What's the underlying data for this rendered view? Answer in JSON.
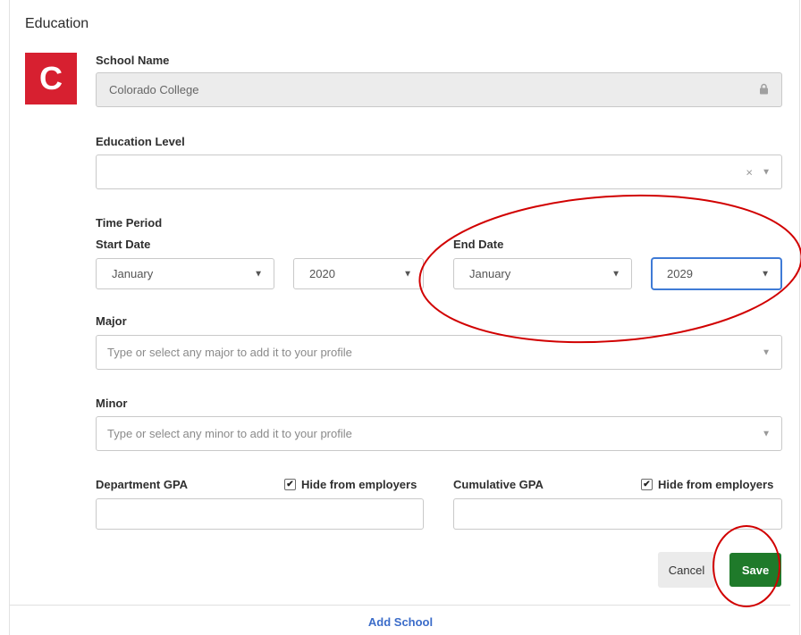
{
  "section": {
    "title": "Education"
  },
  "school": {
    "logo_letter": "C",
    "label": "School Name",
    "value": "Colorado College"
  },
  "education_level": {
    "label": "Education Level",
    "value": ""
  },
  "time_period": {
    "label": "Time Period",
    "start": {
      "label": "Start Date",
      "month": "January",
      "year": "2020"
    },
    "end": {
      "label": "End Date",
      "month": "January",
      "year": "2029"
    }
  },
  "major": {
    "label": "Major",
    "placeholder": "Type or select any major to add it to your profile"
  },
  "minor": {
    "label": "Minor",
    "placeholder": "Type or select any minor to add it to your profile"
  },
  "gpa": {
    "department": {
      "label": "Department GPA",
      "hide_label": "Hide from employers",
      "hidden": true,
      "value": ""
    },
    "cumulative": {
      "label": "Cumulative GPA",
      "hide_label": "Hide from employers",
      "hidden": true,
      "value": ""
    }
  },
  "actions": {
    "cancel": "Cancel",
    "save": "Save"
  },
  "footer": {
    "add_school": "Add School"
  },
  "colors": {
    "logo": "#d72030",
    "save": "#1f7a2a",
    "link": "#3b6cc9",
    "annotation": "#d10000",
    "focus": "#3f7bd6"
  }
}
